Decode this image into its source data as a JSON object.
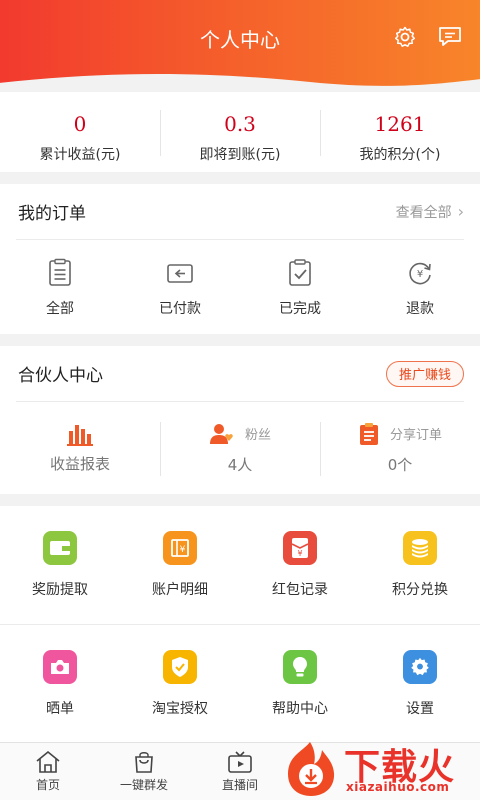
{
  "header": {
    "title": "个人中心",
    "settings_icon": "gear-icon",
    "message_icon": "message-icon"
  },
  "stats": [
    {
      "value": "0",
      "label": "累计收益(元)"
    },
    {
      "value": "0.3",
      "label": "即将到账(元)"
    },
    {
      "value": "1261",
      "label": "我的积分(个)"
    }
  ],
  "orders": {
    "title": "我的订单",
    "view_all": "查看全部",
    "items": [
      {
        "label": "全部",
        "icon": "list-icon"
      },
      {
        "label": "已付款",
        "icon": "wallet-icon"
      },
      {
        "label": "已完成",
        "icon": "check-clipboard-icon"
      },
      {
        "label": "退款",
        "icon": "refund-icon"
      }
    ]
  },
  "partner": {
    "title": "合伙人中心",
    "promo_button": "推广赚钱",
    "items": [
      {
        "label": "收益报表",
        "icon": "bar-chart-icon"
      },
      {
        "label": "粉丝",
        "value": "4人",
        "icon": "fans-icon"
      },
      {
        "label": "分享订单",
        "value": "0个",
        "icon": "share-order-icon"
      }
    ]
  },
  "tools": {
    "row1": [
      {
        "label": "奖励提取",
        "icon": "wallet-icon",
        "color": "#8dc63f"
      },
      {
        "label": "账户明细",
        "icon": "account-detail-icon",
        "color": "#f7941d"
      },
      {
        "label": "红包记录",
        "icon": "red-envelope-icon",
        "color": "#e84c3d"
      },
      {
        "label": "积分兑换",
        "icon": "coins-icon",
        "color": "#f7c21d"
      }
    ],
    "row2": [
      {
        "label": "晒单",
        "icon": "camera-icon",
        "color": "#f0569d"
      },
      {
        "label": "淘宝授权",
        "icon": "shield-check-icon",
        "color": "#f7b500"
      },
      {
        "label": "帮助中心",
        "icon": "lightbulb-icon",
        "color": "#6cc644"
      },
      {
        "label": "设置",
        "icon": "gear-icon",
        "color": "#3d8fe0"
      }
    ]
  },
  "tabbar": [
    {
      "label": "首页",
      "icon": "home-icon"
    },
    {
      "label": "一键群发",
      "icon": "bag-icon"
    },
    {
      "label": "直播间",
      "icon": "tv-icon"
    }
  ],
  "watermark": {
    "brand": "下载火",
    "site": "xiazaihuo.com"
  },
  "colors": {
    "accent": "#f23a2e",
    "stat_value": "#d0021b"
  }
}
